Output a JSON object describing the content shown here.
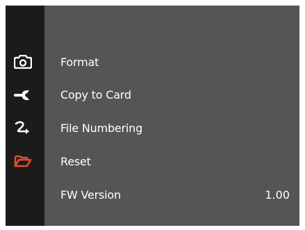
{
  "menu": {
    "items": [
      {
        "label": "Format",
        "icon": "camera-icon",
        "active": false
      },
      {
        "label": "Copy to Card",
        "icon": "wrench-icon",
        "active": false
      },
      {
        "label": "File Numbering",
        "icon": "arrow-route-icon",
        "active": false
      },
      {
        "label": "Reset",
        "icon": "folder-icon",
        "active": true
      },
      {
        "label": "FW Version",
        "value": "1.00"
      }
    ]
  },
  "colors": {
    "background": "#555555",
    "sidebar": "#1b1b1b",
    "icon": "#ffffff",
    "active_icon": "#e84a2f",
    "text": "#ffffff"
  }
}
